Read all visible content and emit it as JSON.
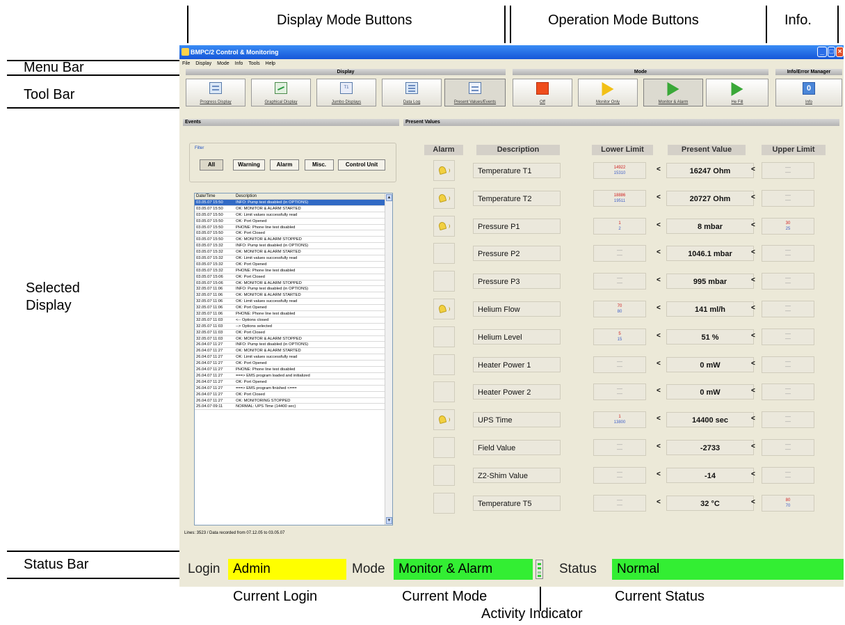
{
  "annotations": {
    "display_mode_buttons": "Display Mode Buttons",
    "operation_mode_buttons": "Operation Mode Buttons",
    "info": "Info.",
    "menu_bar": "Menu Bar",
    "tool_bar": "Tool Bar",
    "selected_display": "Selected Display",
    "status_bar": "Status Bar",
    "current_login": "Current Login",
    "current_mode": "Current Mode",
    "activity_indicator": "Activity Indicator",
    "current_status": "Current Status"
  },
  "window": {
    "title": "BMPC/2 Control & Monitoring",
    "menu": [
      "File",
      "Display",
      "Mode",
      "Info",
      "Tools",
      "Help"
    ]
  },
  "toolbar": {
    "groups": {
      "display": "Display",
      "mode": "Mode",
      "info": "Info/Error Manager"
    },
    "display_buttons": [
      "Progress Display",
      "Graphical Display",
      "Jumbo Displays",
      "Data Log",
      "Present Values/Events"
    ],
    "mode_buttons": [
      "Off",
      "Monitor Only",
      "Monitor & Alarm",
      "He Fill"
    ],
    "info_button": "Info",
    "active_display": "Present Values/Events",
    "active_mode": "Monitor & Alarm"
  },
  "events": {
    "title": "Events",
    "filter_label": "Filter",
    "filters": [
      "All",
      "Warning",
      "Alarm",
      "Misc.",
      "Control Unit"
    ],
    "selected_filter": "All",
    "columns": [
      "Date/Time",
      "Description"
    ],
    "rows": [
      [
        "03.05.07 15:50",
        "INFO: Pump test disabled (in OPTIONS)"
      ],
      [
        "03.05.07 15:50",
        "OK: MONITOR & ALARM STARTED"
      ],
      [
        "03.05.07 15:50",
        "OK: Limit values successfully read"
      ],
      [
        "03.05.07 15:50",
        "OK: Port Opened"
      ],
      [
        "03.05.07 15:50",
        "PHONE: Phone line test disabled"
      ],
      [
        "03.05.07 15:50",
        "OK: Port Closed"
      ],
      [
        "03.05.07 15:50",
        "OK: MONITOR & ALARM STOPPED"
      ],
      [
        "03.05.07 15:32",
        "INFO: Pump test disabled (in OPTIONS)"
      ],
      [
        "03.05.07 15:32",
        "OK: MONITOR & ALARM STARTED"
      ],
      [
        "03.05.07 15:32",
        "OK: Limit values successfully read"
      ],
      [
        "03.05.07 15:32",
        "OK: Port Opened"
      ],
      [
        "03.05.07 15:32",
        "PHONE: Phone line test disabled"
      ],
      [
        "03.05.07 15:06",
        "OK: Port Closed"
      ],
      [
        "03.05.07 15:06",
        "OK: MONITOR & ALARM STOPPED"
      ],
      [
        "32.05.07 11:06",
        "INFO: Pump test disabled (in OPTIONS)"
      ],
      [
        "32.05.07 11:06",
        "OK: MONITOR & ALARM STARTED"
      ],
      [
        "32.05.07 11:06",
        "OK: Limit values successfully read"
      ],
      [
        "32.05.07 11:06",
        "OK: Port Opened"
      ],
      [
        "32.05.07 11:06",
        "PHONE: Phone line test disabled"
      ],
      [
        "32.05.07 11:03",
        "<-- Options closed"
      ],
      [
        "32.05.07 11:03",
        "--> Options selected"
      ],
      [
        "32.05.07 11:03",
        "OK: Port Closed"
      ],
      [
        "32.05.07 11:03",
        "OK: MONITOR & ALARM STOPPED"
      ],
      [
        "26.04.07 11:27",
        "INFO: Pump test disabled (in OPTIONS)"
      ],
      [
        "26.04.07 11:27",
        "OK: MONITOR & ALARM STARTED"
      ],
      [
        "26.04.07 11:27",
        "OK: Limit values successfully read"
      ],
      [
        "26.04.07 11:27",
        "OK: Port Opened"
      ],
      [
        "26.04.07 11:27",
        "PHONE: Phone line test disabled"
      ],
      [
        "26.04.07 11:27",
        "===> EMS program loaded and initialized"
      ],
      [
        "26.04.07 11:27",
        "OK: Port Opened"
      ],
      [
        "26.04.07 11:27",
        "===> EMS program finished <==="
      ],
      [
        "26.04.07 11:27",
        "OK: Port Closed"
      ],
      [
        "26.04.07 11:27",
        "OK: MONITORING STOPPED"
      ],
      [
        "25.04.07 09:11",
        "NORMAL: UPS Time (14400 sec)"
      ]
    ],
    "selected_row": 0,
    "lines_info": "Lines: 3523 / Data recorded from 07.12.05 to 03.05.07"
  },
  "present_values": {
    "title": "Present Values",
    "columns": [
      "Alarm",
      "Description",
      "Lower Limit",
      "Present Value",
      "Upper Limit"
    ],
    "rows": [
      {
        "alarm": true,
        "description": "Temperature T1",
        "lower": [
          "14922",
          "15310"
        ],
        "value": "16247 Ohm",
        "upper": null
      },
      {
        "alarm": true,
        "description": "Temperature T2",
        "lower": [
          "18886",
          "19511"
        ],
        "value": "20727 Ohm",
        "upper": null
      },
      {
        "alarm": true,
        "description": "Pressure P1",
        "lower": [
          "1",
          "2"
        ],
        "value": "8 mbar",
        "upper": [
          "30",
          "25"
        ]
      },
      {
        "alarm": false,
        "description": "Pressure P2",
        "lower": null,
        "value": "1046.1 mbar",
        "upper": null
      },
      {
        "alarm": false,
        "description": "Pressure P3",
        "lower": null,
        "value": "995 mbar",
        "upper": null
      },
      {
        "alarm": true,
        "description": "Helium Flow",
        "lower": [
          "70",
          "80"
        ],
        "value": "141 ml/h",
        "upper": null
      },
      {
        "alarm": false,
        "description": "Helium Level",
        "lower": [
          "5",
          "15"
        ],
        "value": "51 %",
        "upper": null
      },
      {
        "alarm": false,
        "description": "Heater Power 1",
        "lower": null,
        "value": "0 mW",
        "upper": null
      },
      {
        "alarm": false,
        "description": "Heater Power 2",
        "lower": null,
        "value": "0 mW",
        "upper": null
      },
      {
        "alarm": true,
        "description": "UPS Time",
        "lower": [
          "1",
          "13800"
        ],
        "value": "14400 sec",
        "upper": null
      },
      {
        "alarm": false,
        "description": "Field Value",
        "lower": null,
        "value": "-2733",
        "upper": null
      },
      {
        "alarm": false,
        "description": "Z2-Shim Value",
        "lower": null,
        "value": "-14",
        "upper": null
      },
      {
        "alarm": false,
        "description": "Temperature T5",
        "lower": null,
        "value": "32 °C",
        "upper": [
          "80",
          "70"
        ]
      }
    ],
    "lt_symbol": "<",
    "dash": "—"
  },
  "status_bar": {
    "login_label": "Login",
    "login_value": "Admin",
    "mode_label": "Mode",
    "mode_value": "Monitor & Alarm",
    "status_label": "Status",
    "status_value": "Normal"
  },
  "colors": {
    "login_bg": "#ffff00",
    "mode_bg": "#33ee33",
    "status_bg": "#33ee33",
    "alarm_bell": "#f2d040",
    "selected_row": "#316ac5"
  }
}
